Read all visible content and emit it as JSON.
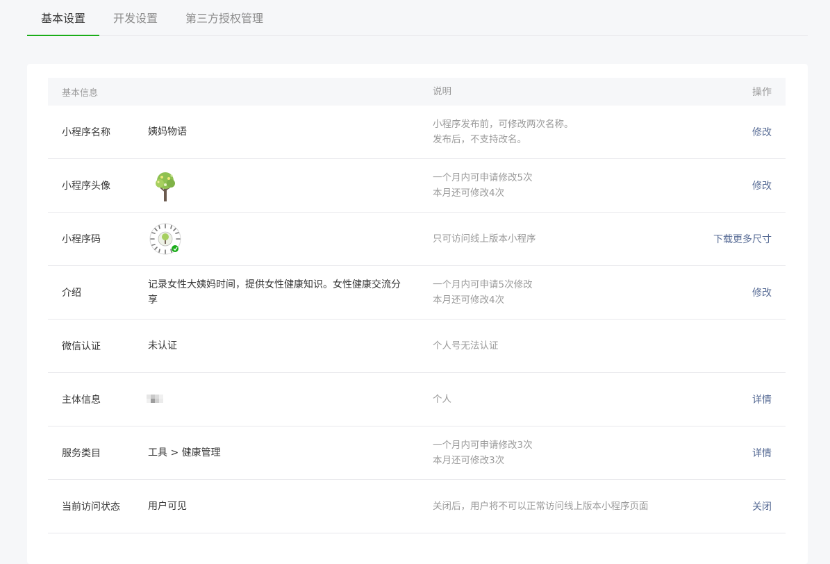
{
  "tabs": [
    {
      "label": "基本设置",
      "active": true
    },
    {
      "label": "开发设置",
      "active": false
    },
    {
      "label": "第三方授权管理",
      "active": false
    }
  ],
  "table": {
    "headers": {
      "info": "基本信息",
      "desc": "说明",
      "op": "操作"
    },
    "rows": [
      {
        "label": "小程序名称",
        "value": "姨妈物语",
        "desc": [
          "小程序发布前，可修改两次名称。",
          "发布后，不支持改名。"
        ],
        "op": "修改"
      },
      {
        "label": "小程序头像",
        "value": "",
        "desc": [
          "一个月内可申请修改5次",
          "本月还可修改4次"
        ],
        "op": "修改"
      },
      {
        "label": "小程序码",
        "value": "",
        "desc": [
          "只可访问线上版本小程序"
        ],
        "op": "下载更多尺寸"
      },
      {
        "label": "介绍",
        "value": "记录女性大姨妈时间，提供女性健康知识。女性健康交流分享",
        "desc": [
          "一个月内可申请5次修改",
          "本月还可修改4次"
        ],
        "op": "修改"
      },
      {
        "label": "微信认证",
        "value": "未认证",
        "desc": [
          "个人号无法认证"
        ],
        "op": ""
      },
      {
        "label": "主体信息",
        "value": "",
        "desc": [
          "个人"
        ],
        "op": "详情"
      },
      {
        "label": "服务类目",
        "value": "工具 > 健康管理",
        "desc": [
          "一个月内可申请修改3次",
          "本月还可修改3次"
        ],
        "op": "详情"
      },
      {
        "label": "当前访问状态",
        "value": "用户可见",
        "desc": [
          "关闭后，用户将不可以正常访问线上版本小程序页面"
        ],
        "op": "关闭"
      }
    ]
  },
  "colors": {
    "accent": "#1aad19",
    "link": "#576b95",
    "muted": "#9a9a9a"
  }
}
